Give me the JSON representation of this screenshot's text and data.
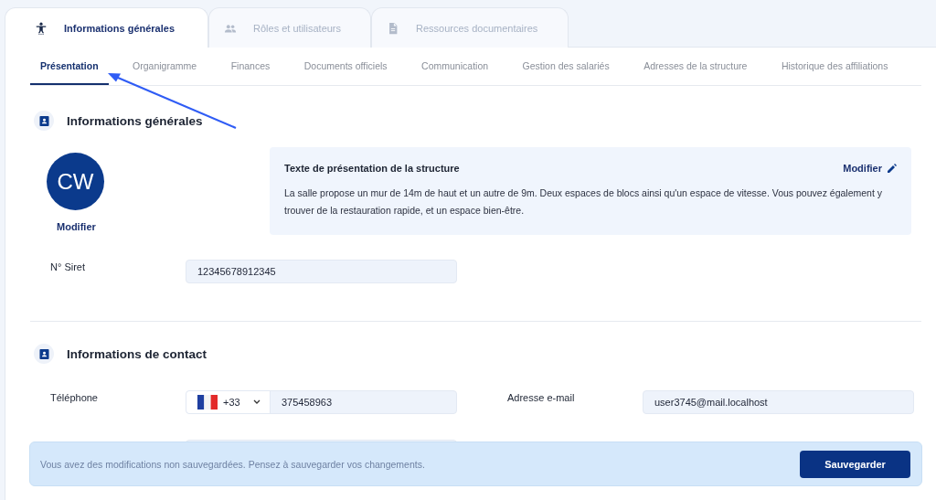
{
  "top_tabs": [
    {
      "label": "Informations générales",
      "selected": true
    },
    {
      "label": "Rôles et utilisateurs",
      "selected": false
    },
    {
      "label": "Ressources documentaires",
      "selected": false
    }
  ],
  "sub_tabs": [
    {
      "label": "Présentation",
      "selected": true
    },
    {
      "label": "Organigramme",
      "selected": false
    },
    {
      "label": "Finances",
      "selected": false
    },
    {
      "label": "Documents officiels",
      "selected": false
    },
    {
      "label": "Communication",
      "selected": false
    },
    {
      "label": "Gestion des salariés",
      "selected": false
    },
    {
      "label": "Adresses de la structure",
      "selected": false
    },
    {
      "label": "Historique des affiliations",
      "selected": false
    }
  ],
  "general": {
    "title": "Informations générales",
    "avatar": {
      "initials": "CW",
      "action": "Modifier"
    },
    "presentation": {
      "title": "Texte de présentation de la structure",
      "action": "Modifier",
      "text": "La salle propose un mur de 14m de haut et un autre de 9m. Deux espaces de blocs ainsi qu'un espace de vitesse. Vous pouvez également y trouver de la restauration rapide, et un espace bien-être."
    },
    "siret": {
      "label": "N° Siret",
      "value": "12345678912345"
    }
  },
  "contact": {
    "title": "Informations de contact",
    "phone": {
      "label": "Téléphone",
      "country_code": "+33",
      "value": "375458963"
    },
    "email": {
      "label": "Adresse e-mail",
      "value": "user3745@mail.localhost"
    }
  },
  "unsaved_banner": {
    "message": "Vous avez des modifications non sauvegardées. Pensez à sauvegarder vos changements.",
    "button": "Sauvegarder"
  }
}
